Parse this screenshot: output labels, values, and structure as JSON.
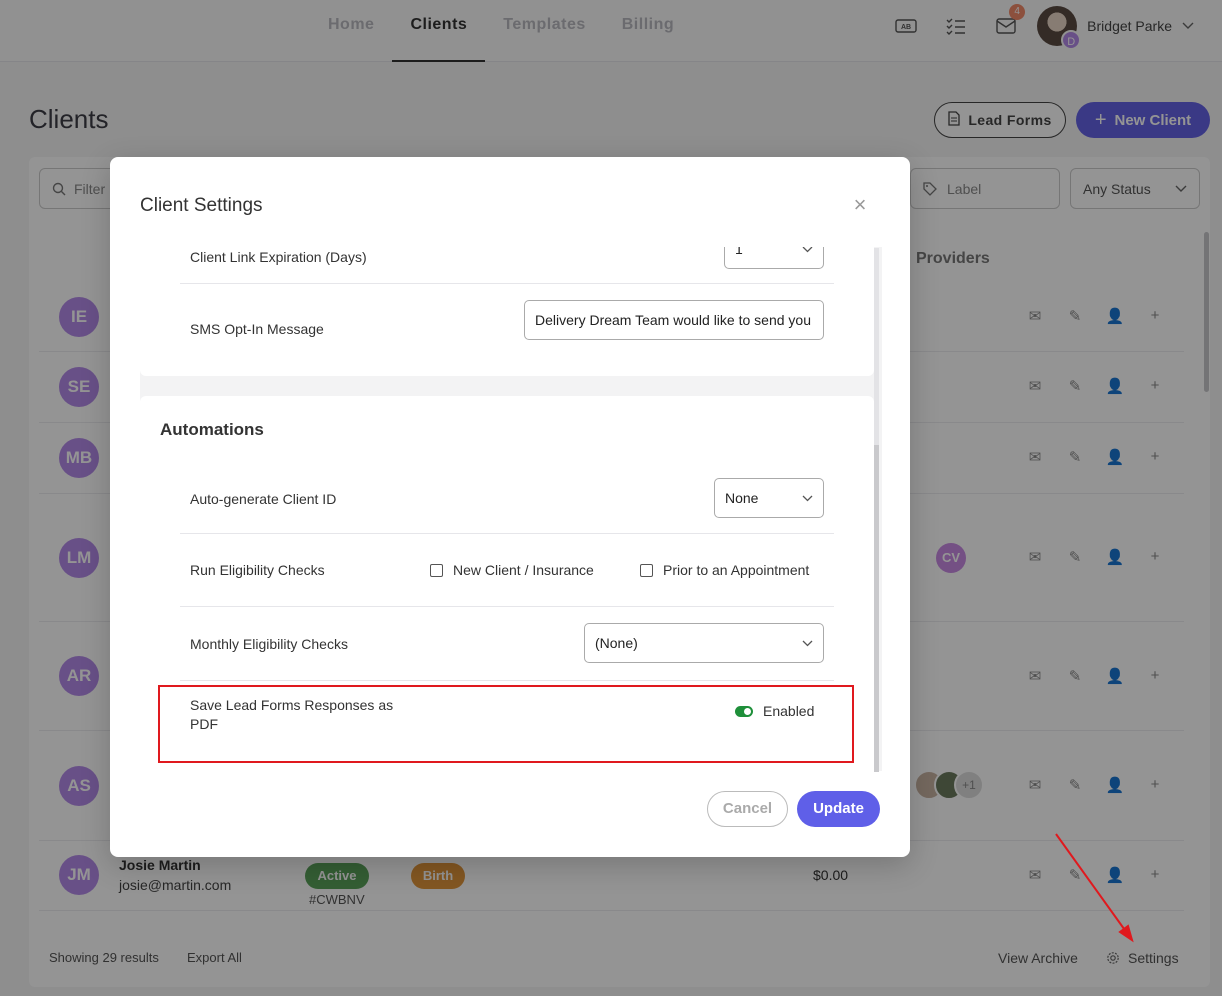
{
  "nav": {
    "tabs": [
      {
        "label": "Home"
      },
      {
        "label": "Clients"
      },
      {
        "label": "Templates"
      },
      {
        "label": "Billing"
      }
    ],
    "message_badge": "4",
    "user_initial": "D",
    "user_name": "Bridget Parke"
  },
  "page": {
    "title": "Clients",
    "lead_forms_label": "Lead Forms",
    "new_client_label": "New Client"
  },
  "filters": {
    "filter_placeholder": "Filter",
    "label_placeholder": "Label",
    "status_value": "Any Status"
  },
  "table": {
    "providers_header": "Providers",
    "rows": [
      {
        "initials": "IE"
      },
      {
        "initials": "SE"
      },
      {
        "initials": "MB"
      },
      {
        "initials": "LM",
        "provider": "CV"
      },
      {
        "initials": "AR"
      },
      {
        "initials": "AS",
        "provider_extra": "+1"
      },
      {
        "initials": "JM",
        "name": "Josie Martin",
        "email": "josie@martin.com",
        "status": "Active",
        "code": "#CWBNV",
        "tag": "Birth",
        "amount": "$0.00"
      }
    ]
  },
  "footer": {
    "results": "Showing 29 results",
    "export": "Export All",
    "archive": "View Archive",
    "settings": "Settings"
  },
  "modal": {
    "title": "Client Settings",
    "link_expiration_label": "Client Link Expiration (Days)",
    "link_expiration_value": "1",
    "sms_label": "SMS Opt-In Message",
    "sms_value": "Delivery Dream Team would like to send you",
    "automations_heading": "Automations",
    "auto_id_label": "Auto-generate Client ID",
    "auto_id_value": "None",
    "eligibility_label": "Run Eligibility Checks",
    "eligibility_opt1": "New Client / Insurance",
    "eligibility_opt2": "Prior to an Appointment",
    "monthly_label": "Monthly Eligibility Checks",
    "monthly_value": "(None)",
    "save_pdf_label_line1": "Save Lead Forms Responses as",
    "save_pdf_label_line2": "PDF",
    "save_pdf_status": "Enabled",
    "cancel_label": "Cancel",
    "update_label": "Update"
  },
  "colors": {
    "accent": "#6462e6",
    "avatar": "#b48be8",
    "highlight": "#e0191e",
    "toggle_on": "#1e8f3a"
  }
}
